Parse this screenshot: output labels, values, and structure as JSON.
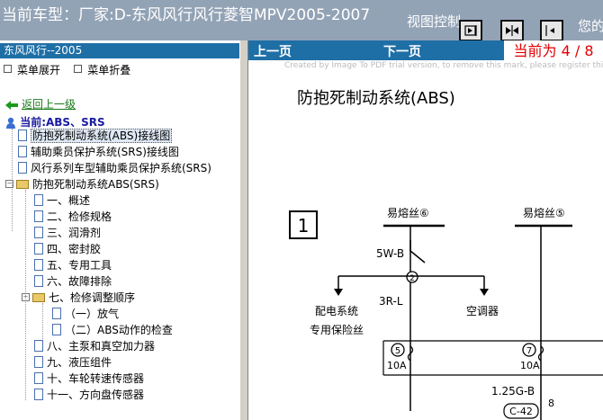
{
  "header": {
    "title": "当前车型：厂家:D-东风风行风行菱智MPV2005-2007",
    "view_control": "视图控制",
    "extra": "您的"
  },
  "left_panel": {
    "head": "东风风行--2005",
    "menu_expand": "菜单展开",
    "menu_collapse": "菜单折叠",
    "back": "返回上一级",
    "current": "当前:ABS、SRS",
    "items": [
      {
        "label": "防抱死制动系统(ABS)接线图",
        "type": "doc"
      },
      {
        "label": "辅助乘员保护系统(SRS)接线图",
        "type": "doc"
      },
      {
        "label": "风行系列车型辅助乘员保护系统(SRS)",
        "type": "doc"
      },
      {
        "label": "防抱死制动系统ABS(SRS)",
        "type": "folder"
      },
      {
        "label": "一、概述",
        "type": "doc"
      },
      {
        "label": "二、检修规格",
        "type": "doc"
      },
      {
        "label": "三、润滑剂",
        "type": "doc"
      },
      {
        "label": "四、密封胶",
        "type": "doc"
      },
      {
        "label": "五、专用工具",
        "type": "doc"
      },
      {
        "label": "六、故障排除",
        "type": "doc"
      },
      {
        "label": "七、检修调整顺序",
        "type": "folder"
      },
      {
        "label": "（一）放气",
        "type": "doc"
      },
      {
        "label": "（二）ABS动作的检查",
        "type": "doc"
      },
      {
        "label": "八、主泵和真空加力器",
        "type": "doc"
      },
      {
        "label": "九、液压组件",
        "type": "doc"
      },
      {
        "label": "十、车轮转速传感器",
        "type": "doc"
      },
      {
        "label": "十一、方向盘传感器",
        "type": "doc"
      }
    ]
  },
  "right_panel": {
    "prev": "上一页",
    "next": "下一页",
    "page_indicator": "当前为 4 / 8",
    "watermark": "Created by Image To PDF trial version, to remove this mark, please register this software.",
    "doc_title": "防抱死制动系统(ABS)",
    "diagram": {
      "box_label": "1",
      "fuse6": "易熔丝⑥",
      "fuse5": "易熔丝⑤",
      "wire1": "5W-B",
      "node2": "2",
      "wire2": "3R-L",
      "dist": "配电系统",
      "ac": "空调器",
      "special_fuse": "专用保险丝",
      "fuse_a": "5",
      "fuse_b": "7",
      "amp_a": "10A",
      "amp_b": "10A",
      "wire3": "1.25G-B",
      "connector": "C-42",
      "pin": "8"
    }
  }
}
